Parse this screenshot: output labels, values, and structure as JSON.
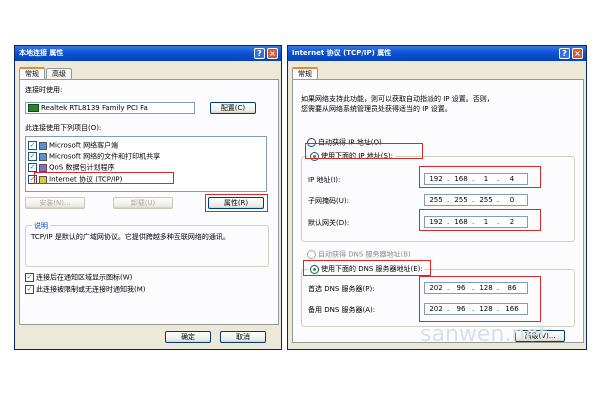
{
  "left_dialog": {
    "title": "本地连接 属性",
    "tabs": [
      "常规",
      "高级"
    ],
    "connect_using_label": "连接时使用:",
    "adapter_name": "Realtek RTL8139 Family PCI Fa",
    "configure_button": "配置(C)",
    "items_label": "此连接使用下列项目(O):",
    "items": [
      {
        "label": "Microsoft 网络客户端",
        "checked": true,
        "icon": "network-client-icon"
      },
      {
        "label": "Microsoft 网络的文件和打印机共享",
        "checked": true,
        "icon": "file-printer-sharing-icon"
      },
      {
        "label": "QoS 数据包计划程序",
        "checked": true,
        "icon": "qos-icon"
      },
      {
        "label": "Internet 协议 (TCP/IP)",
        "checked": true,
        "icon": "protocol-icon"
      }
    ],
    "install_button": "安装(N)...",
    "uninstall_button": "卸载(U)",
    "properties_button": "属性(R)",
    "description_label": "说明",
    "description_text": "TCP/IP 是默认的广域网协议。它提供跨越多种互联网络的通讯。",
    "show_icon_label": "连接后在通知区域显示图标(W)",
    "notify_label": "此连接被限制或无连接时通知我(M)",
    "ok_button": "确定",
    "cancel_button": "取消"
  },
  "right_dialog": {
    "title": "Internet 协议 (TCP/IP) 属性",
    "tabs": [
      "常规"
    ],
    "intro_text_1": "如果网络支持此功能，则可以获取自动指派的 IP 设置。否则，",
    "intro_text_2": "您需要从网络系统管理员处获得适当的 IP 设置。",
    "auto_ip_label": "自动获得 IP 地址(O)",
    "use_ip_label": "使用下面的 IP 地址(S):",
    "ip_address_label": "IP 地址(I):",
    "ip_address": [
      "192",
      "168",
      "1",
      "4"
    ],
    "subnet_label": "子网掩码(U):",
    "subnet_mask": [
      "255",
      "255",
      "255",
      "0"
    ],
    "gateway_label": "默认网关(D):",
    "gateway": [
      "192",
      "168",
      "1",
      "2"
    ],
    "auto_dns_label": "自动获得 DNS 服务器地址(B)",
    "use_dns_label": "使用下面的 DNS 服务器地址(E):",
    "preferred_dns_label": "首选 DNS 服务器(P):",
    "preferred_dns": [
      "202",
      "96",
      "128",
      "86"
    ],
    "alternate_dns_label": "备用 DNS 服务器(A):",
    "alternate_dns": [
      "202",
      "96",
      "128",
      "166"
    ],
    "advanced_button": "高级(V)..."
  },
  "watermark": "sanwen.net",
  "colors": {
    "highlight": "#d62a2a",
    "titlebar": "#0b53d6"
  }
}
